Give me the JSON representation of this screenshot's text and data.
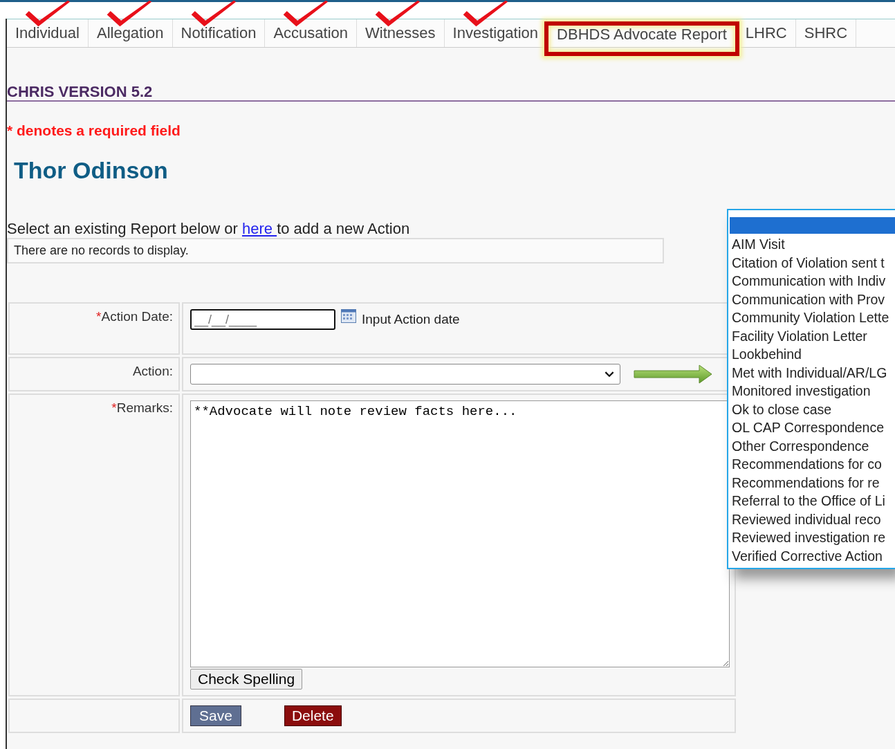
{
  "tabs": [
    {
      "label": "Individual",
      "checked": true,
      "highlighted": false
    },
    {
      "label": "Allegation",
      "checked": true,
      "highlighted": false
    },
    {
      "label": "Notification",
      "checked": true,
      "highlighted": false
    },
    {
      "label": "Accusation",
      "checked": true,
      "highlighted": false
    },
    {
      "label": "Witnesses",
      "checked": true,
      "highlighted": false
    },
    {
      "label": "Investigation",
      "checked": true,
      "highlighted": false
    },
    {
      "label": "DBHDS Advocate Report",
      "checked": false,
      "highlighted": true
    },
    {
      "label": "LHRC",
      "checked": false,
      "highlighted": false
    },
    {
      "label": "SHRC",
      "checked": false,
      "highlighted": false
    }
  ],
  "version": "CHRIS VERSION 5.2",
  "required_note": "* denotes a required field",
  "person_name": "Thor Odinson",
  "intro": {
    "before": "Select an existing Report below or ",
    "link": "here ",
    "after": "to add a new Action"
  },
  "records_message": "There are no records to display.",
  "required_mark": "*",
  "form": {
    "action_date": {
      "label": "Action Date:",
      "required": true,
      "placeholder": "__/__/____",
      "hint": "Input Action date"
    },
    "action": {
      "label": "Action:",
      "required": false
    },
    "remarks": {
      "label": "Remarks:",
      "required": true,
      "value": "**Advocate will note review facts here..."
    },
    "check_spelling": "Check Spelling",
    "save": "Save",
    "delete": "Delete"
  },
  "action_options": [
    "AIM Visit",
    "Citation of Violation sent t",
    "Communication with Indiv",
    "Communication with Prov",
    "Community Violation Lette",
    "Facility Violation Letter",
    "Lookbehind",
    "Met with Individual/AR/LG",
    "Monitored investigation",
    "Ok to close case",
    "OL CAP Correspondence",
    "Other Correspondence",
    "Recommendations for co",
    "Recommendations for re",
    "Referral to the Office of Li",
    "Reviewed individual reco",
    "Reviewed investigation re",
    "Verified Corrective Action"
  ]
}
